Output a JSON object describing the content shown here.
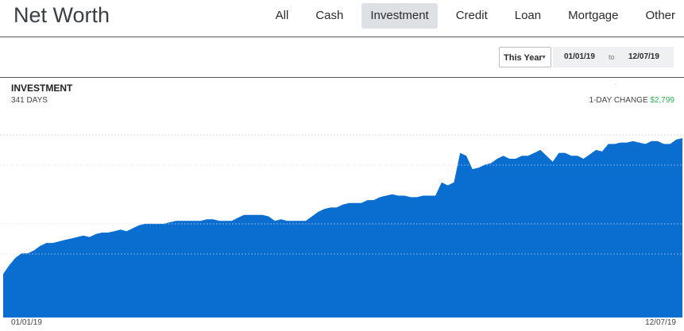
{
  "header": {
    "title": "Net Worth",
    "tabs": [
      {
        "label": "All",
        "active": false
      },
      {
        "label": "Cash",
        "active": false
      },
      {
        "label": "Investment",
        "active": true
      },
      {
        "label": "Credit",
        "active": false
      },
      {
        "label": "Loan",
        "active": false
      },
      {
        "label": "Mortgage",
        "active": false
      },
      {
        "label": "Other",
        "active": false
      }
    ]
  },
  "toolbar": {
    "range_select": "This Year",
    "date_from": "01/01/19",
    "to_label": "to",
    "date_to": "12/07/19"
  },
  "section": {
    "title": "INVESTMENT",
    "days": "341 DAYS",
    "change_label": "1-DAY CHANGE",
    "change_value": "$2,799",
    "dot": "."
  },
  "colors": {
    "accent": "#0a6ed1",
    "positive": "#2eb152",
    "active_tab_bg": "#dde1e6"
  },
  "chart_data": {
    "type": "area",
    "x_start_label": "01/01/19",
    "x_end_label": "12/07/19",
    "grid": true,
    "ylim": [
      0,
      100
    ],
    "values": [
      8,
      14,
      19,
      22,
      22,
      24,
      27,
      29,
      29,
      30,
      31,
      32,
      33,
      34,
      33,
      35,
      36,
      36,
      37,
      38,
      37,
      39,
      41,
      42,
      42,
      42,
      42,
      43,
      44,
      44,
      44,
      44,
      44,
      45,
      45,
      44,
      44,
      44,
      46,
      48,
      48,
      48,
      48,
      47,
      44,
      45,
      44,
      44,
      44,
      44,
      47,
      50,
      52,
      53,
      53,
      55,
      56,
      56,
      56,
      58,
      58,
      60,
      61,
      62,
      61,
      61,
      60,
      60,
      61,
      61,
      61,
      70,
      68,
      70,
      90,
      88,
      79,
      80,
      82,
      83,
      86,
      88,
      86,
      86,
      88,
      88,
      90,
      92,
      88,
      84,
      90,
      90,
      88,
      88,
      86,
      89,
      92,
      91,
      96,
      96,
      97,
      97,
      98,
      97,
      96,
      98,
      98,
      96,
      96,
      99,
      100
    ]
  }
}
